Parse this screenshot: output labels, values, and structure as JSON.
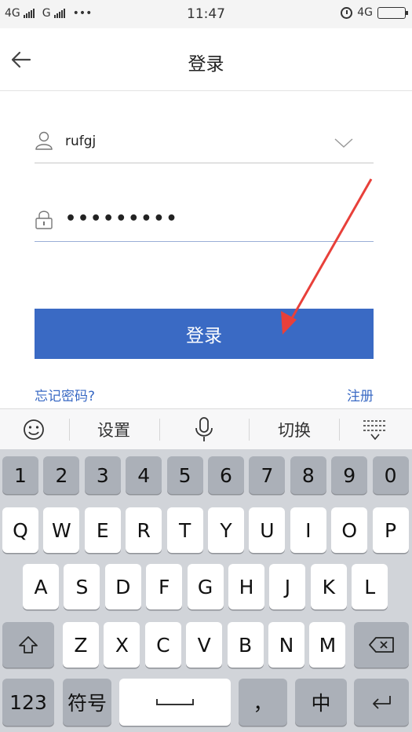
{
  "status_bar": {
    "left_text": "4G",
    "left_text_2": "G",
    "dots": "•••",
    "time": "11:47",
    "network": "4G"
  },
  "nav": {
    "title": "登录"
  },
  "form": {
    "username_value": "rufgj",
    "password_mask": "•••••••••",
    "login_label": "登录",
    "forgot_label": "忘记密码?",
    "register_label": "注册"
  },
  "keyboard_toolbar": {
    "settings_label": "设置",
    "switch_label": "切换"
  },
  "keyboard": {
    "number_row": [
      "1",
      "2",
      "3",
      "4",
      "5",
      "6",
      "7",
      "8",
      "9",
      "0"
    ],
    "row1": [
      "Q",
      "W",
      "E",
      "R",
      "T",
      "Y",
      "U",
      "I",
      "O",
      "P"
    ],
    "row2": [
      "A",
      "S",
      "D",
      "F",
      "G",
      "H",
      "J",
      "K",
      "L"
    ],
    "row3": [
      "Z",
      "X",
      "C",
      "V",
      "B",
      "N",
      "M"
    ],
    "num_switch": "123",
    "symbols": "符号",
    "comma": "，",
    "lang": "中"
  },
  "colors": {
    "accent": "#3a6ac4",
    "arrow": "#e8403a",
    "keyboard_bg": "#d1d4d9"
  }
}
